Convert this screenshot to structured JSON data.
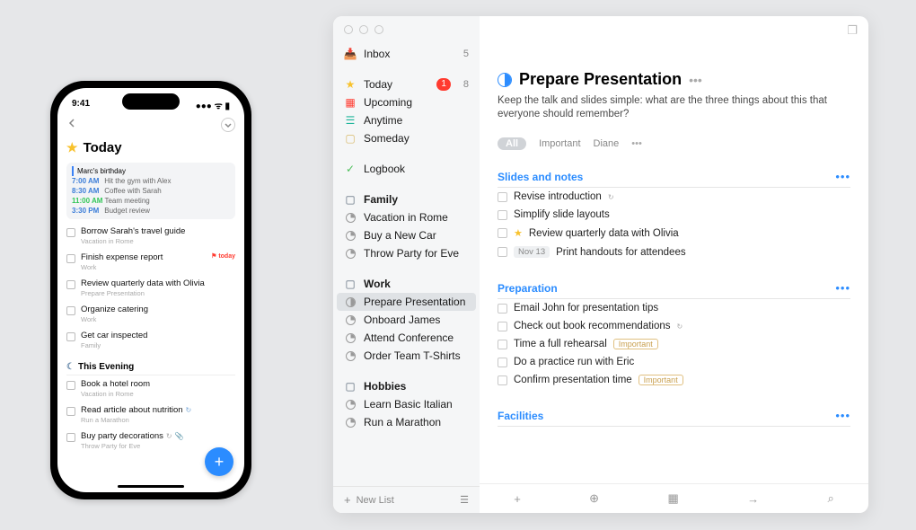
{
  "phone": {
    "time": "9:41",
    "today_title": "Today",
    "calendar": {
      "event_bar": "Marc's birthday",
      "lines": [
        {
          "time": "7:00 AM",
          "text": "Hit the gym with Alex",
          "cls": "blue"
        },
        {
          "time": "8:30 AM",
          "text": "Coffee with Sarah",
          "cls": "blue"
        },
        {
          "time": "11:00 AM",
          "text": "Team meeting",
          "cls": "green"
        },
        {
          "time": "3:30 PM",
          "text": "Budget review",
          "cls": "blue"
        }
      ]
    },
    "tasks": [
      {
        "title": "Borrow Sarah's travel guide",
        "sub": "Vacation in Rome"
      },
      {
        "title": "Finish expense report",
        "sub": "Work",
        "flag": "today"
      },
      {
        "title": "Review quarterly data with Olivia",
        "sub": "Prepare Presentation"
      },
      {
        "title": "Organize catering",
        "sub": "Work"
      },
      {
        "title": "Get car inspected",
        "sub": "Family"
      }
    ],
    "evening_head": "This Evening",
    "evening": [
      {
        "title": "Book a hotel room",
        "sub": "Vacation in Rome"
      },
      {
        "title": "Read article about nutrition",
        "sub": "Run a Marathon",
        "repeat": true
      },
      {
        "title": "Buy party decorations",
        "sub": "Throw Party for Eve",
        "repeat": true,
        "clip": true
      }
    ]
  },
  "sidebar": {
    "inbox": {
      "label": "Inbox",
      "count": "5"
    },
    "today": {
      "label": "Today",
      "badge": "1",
      "count": "8"
    },
    "upcoming": {
      "label": "Upcoming"
    },
    "anytime": {
      "label": "Anytime"
    },
    "someday": {
      "label": "Someday"
    },
    "logbook": {
      "label": "Logbook"
    },
    "areas": [
      {
        "label": "Family",
        "projects": [
          "Vacation in Rome",
          "Buy a New Car",
          "Throw Party for Eve"
        ]
      },
      {
        "label": "Work",
        "projects": [
          "Prepare Presentation",
          "Onboard James",
          "Attend Conference",
          "Order Team T-Shirts"
        ]
      },
      {
        "label": "Hobbies",
        "projects": [
          "Learn Basic Italian",
          "Run a Marathon"
        ]
      }
    ],
    "newlist": "New List"
  },
  "project": {
    "title": "Prepare Presentation",
    "desc": "Keep the talk and slides simple: what are the three things about this that everyone should remember?",
    "tags": {
      "all": "All",
      "t1": "Important",
      "t2": "Diane"
    },
    "sections": [
      {
        "title": "Slides and notes",
        "items": [
          {
            "text": "Revise introduction",
            "repeat": true
          },
          {
            "text": "Simplify slide layouts"
          },
          {
            "text": "Review quarterly data with Olivia",
            "star": true
          },
          {
            "text": "Print handouts for attendees",
            "date": "Nov 13"
          }
        ]
      },
      {
        "title": "Preparation",
        "items": [
          {
            "text": "Email John for presentation tips"
          },
          {
            "text": "Check out book recommendations",
            "repeat": true
          },
          {
            "text": "Time a full rehearsal",
            "imp": "Important"
          },
          {
            "text": "Do a practice run with Eric"
          },
          {
            "text": "Confirm presentation time",
            "imp": "Important"
          }
        ]
      },
      {
        "title": "Facilities",
        "items": []
      }
    ]
  }
}
